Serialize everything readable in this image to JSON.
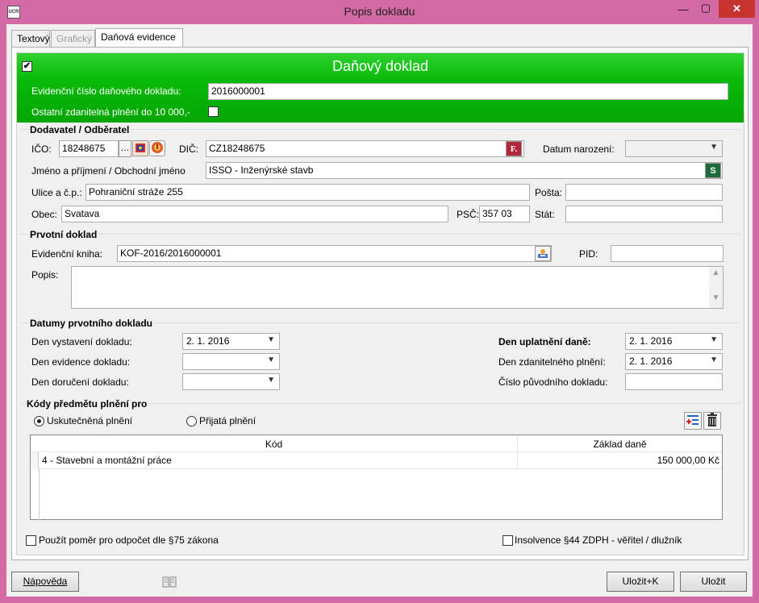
{
  "window": {
    "title": "Popis dokladu",
    "app_icon_text": "UCR",
    "minimize": "—",
    "maximize": "▢",
    "close": "✕"
  },
  "tabs": [
    {
      "label": "Textový",
      "state": "normal"
    },
    {
      "label": "Grafický",
      "state": "disabled"
    },
    {
      "label": "Daňová evidence",
      "state": "active"
    }
  ],
  "header": {
    "checkbox_checked": "✔",
    "title": "Daňový doklad",
    "evid_label": "Evidenční číslo daňového dokladu:",
    "evid_value": "2016000001",
    "ostatni_label": "Ostatní zdanitelná plnění do 10 000,-",
    "ostatni_checked": ""
  },
  "dodavatel": {
    "heading": "Dodavatel / Odběratel",
    "ico_label": "IČO:",
    "ico_value": "18248675",
    "browse_glyph": "…",
    "dic_label": "DIČ:",
    "dic_value": "CZ18248675",
    "dic_button_glyph": "F.",
    "datum_label": "Datum narození:",
    "datum_value": "",
    "jmeno_label": "Jméno a příjmení / Obchodní jméno",
    "jmeno_value": "ISSO - Inženýrské stavb",
    "jmeno_button_glyph": "S",
    "ulice_label": "Ulice a č.p.:",
    "ulice_value": "Pohraniční stráže 255",
    "posta_label": "Pošta:",
    "posta_value": "",
    "obec_label": "Obec:",
    "obec_value": "Svatava",
    "psc_label": "PSČ:",
    "psc_value": "357 03",
    "stat_label": "Stát:",
    "stat_value": ""
  },
  "prvotni": {
    "heading": "Prvotní doklad",
    "kniha_label": "Evidenční kniha:",
    "kniha_value": "KOF-2016/2016000001",
    "pid_label": "PID:",
    "pid_value": "",
    "popis_label": "Popis:",
    "popis_value": ""
  },
  "datumy": {
    "heading": "Datumy prvotního dokladu",
    "vystaveni_label": "Den vystavení dokladu:",
    "vystaveni_value": "2. 1. 2016",
    "evidence_label": "Den evidence dokladu:",
    "evidence_value": "",
    "doruceni_label": "Den doručení dokladu:",
    "doruceni_value": "",
    "uplatneni_label": "Den uplatnění daně:",
    "uplatneni_value": "2. 1. 2016",
    "zdanitelneho_label": "Den zdanitelného plnění:",
    "zdanitelneho_value": "2. 1. 2016",
    "puvodniho_label": "Číslo původního dokladu:",
    "puvodniho_value": ""
  },
  "kody": {
    "heading": "Kódy předmětu plnění pro",
    "radio_uskutecnena": "Uskutečněná plnění",
    "radio_prijata": "Přijatá plnění",
    "columns": [
      "Kód",
      "Základ daně"
    ],
    "rows": [
      {
        "kod": "4 - Stavební a montážní práce",
        "zaklad": "150 000,00 Kč"
      }
    ]
  },
  "footer_checks": {
    "pomer_label": "Použít poměr pro odpočet dle §75 zákona",
    "insolvence_label": "Insolvence §44 ZDPH - věřitel / dlužník"
  },
  "buttons": {
    "napoveda": "Nápověda",
    "ulozit_k": "Uložit+K",
    "ulozit": "Uložit"
  },
  "colors": {
    "accent_green": "#08b908",
    "window_frame": "#d36aa6"
  }
}
